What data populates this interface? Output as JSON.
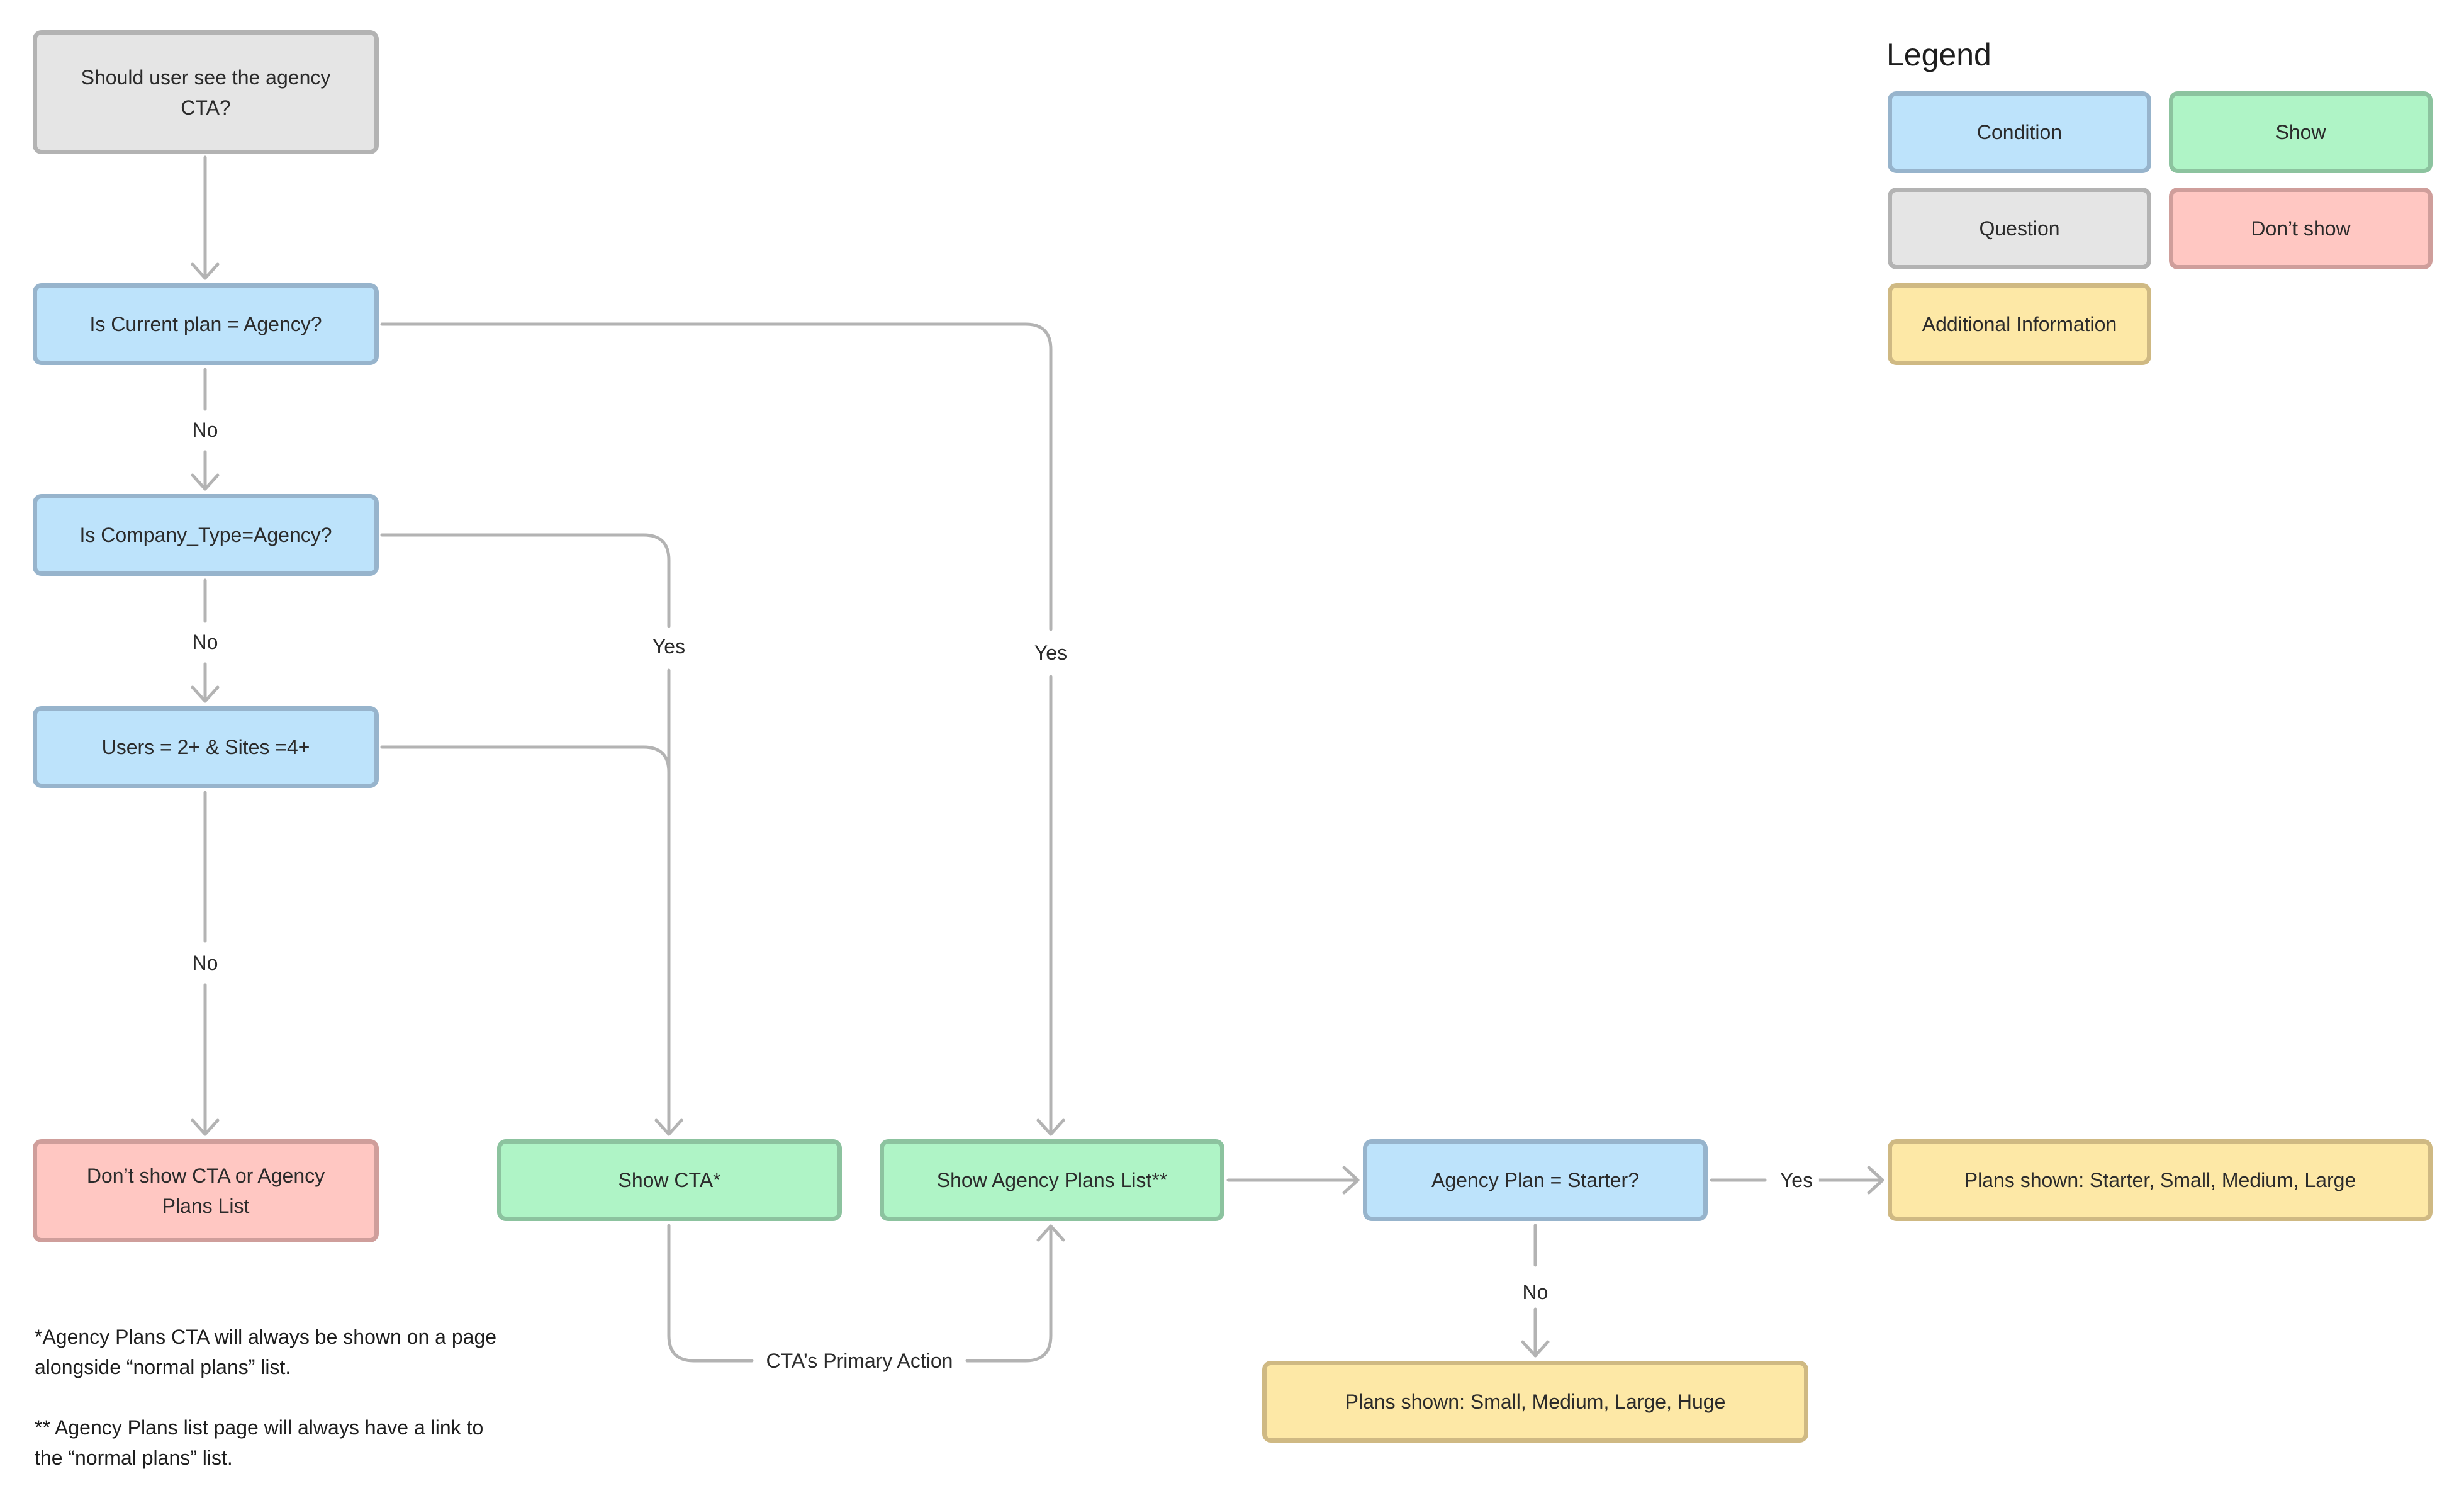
{
  "diagram": {
    "nodes": {
      "start": {
        "text": "Should user see the agency CTA?",
        "type": "Question"
      },
      "current_plan": {
        "text": "Is Current plan = Agency?",
        "type": "Condition"
      },
      "company_type": {
        "text": "Is Company_Type=Agency?",
        "type": "Condition"
      },
      "users_sites": {
        "text": "Users = 2+ & Sites =4+",
        "type": "Condition"
      },
      "dont_show": {
        "text": "Don’t show CTA or Agency Plans List",
        "type": "Don't show"
      },
      "show_cta": {
        "text": "Show CTA*",
        "type": "Show"
      },
      "show_agency_list": {
        "text": "Show Agency Plans List**",
        "type": "Show"
      },
      "agency_starter": {
        "text": "Agency Plan = Starter?",
        "type": "Condition"
      },
      "plans_starter": {
        "text": "Plans shown: Starter, Small, Medium, Large",
        "type": "Additional Information"
      },
      "plans_huge": {
        "text": "Plans shown: Small, Medium, Large, Huge",
        "type": "Additional Information"
      }
    },
    "edges": [
      {
        "from": "start",
        "to": "current_plan",
        "label": ""
      },
      {
        "from": "current_plan",
        "to": "company_type",
        "label": "No"
      },
      {
        "from": "current_plan",
        "to": "show_agency_list",
        "label": "Yes"
      },
      {
        "from": "company_type",
        "to": "users_sites",
        "label": "No"
      },
      {
        "from": "company_type",
        "to": "show_cta",
        "label": "Yes"
      },
      {
        "from": "users_sites",
        "to": "show_cta",
        "label": ""
      },
      {
        "from": "users_sites",
        "to": "dont_show",
        "label": "No"
      },
      {
        "from": "show_cta",
        "to": "show_agency_list",
        "label": "CTA’s Primary Action"
      },
      {
        "from": "show_agency_list",
        "to": "agency_starter",
        "label": ""
      },
      {
        "from": "agency_starter",
        "to": "plans_starter",
        "label": "Yes"
      },
      {
        "from": "agency_starter",
        "to": "plans_huge",
        "label": "No"
      }
    ],
    "edge_labels": {
      "no1": "No",
      "no2": "No",
      "no3": "No",
      "no4": "No",
      "yes_company": "Yes",
      "yes_current": "Yes",
      "yes_starter": "Yes",
      "cta_action": "CTA’s Primary Action"
    }
  },
  "legend": {
    "title": "Legend",
    "items": [
      {
        "label": "Condition",
        "color": "#bde3fb",
        "border": "#97b4cc"
      },
      {
        "label": "Show",
        "color": "#aff4c6",
        "border": "#8cc39f"
      },
      {
        "label": "Question",
        "color": "#e5e5e5",
        "border": "#b3b3b3"
      },
      {
        "label": "Don’t show",
        "color": "#ffc7c2",
        "border": "#cf9e9b"
      },
      {
        "label": "Additional Information",
        "color": "#fde8a6",
        "border": "#cfb983"
      }
    ]
  },
  "notes": {
    "note1": "*Agency Plans CTA will always be shown on a page alongside “normal plans” list.",
    "note2": "** Agency Plans list page will always have a link to the “normal plans” list."
  }
}
